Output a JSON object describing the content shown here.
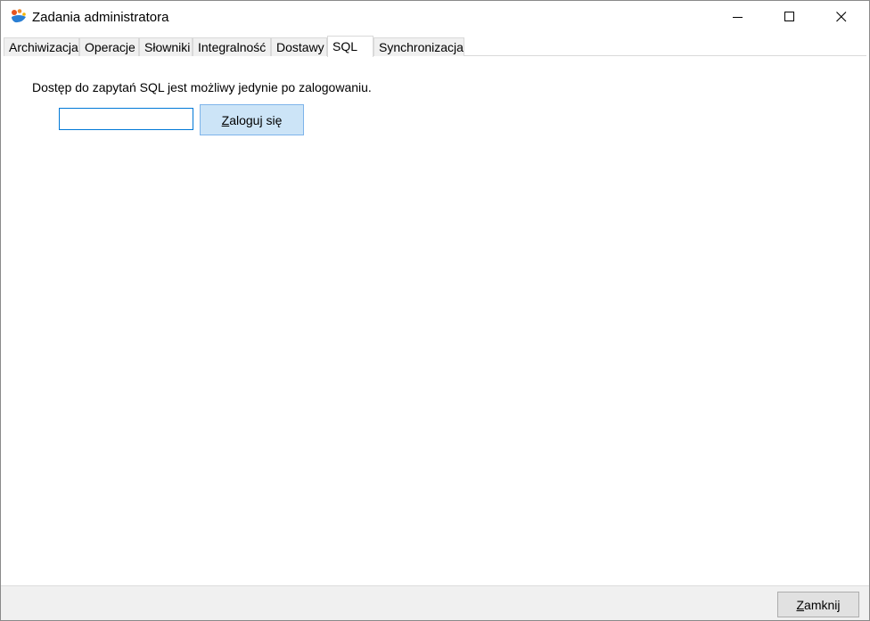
{
  "window": {
    "title": "Zadania administratora",
    "app_icon": "app-logo-icon",
    "controls": {
      "minimize_icon": "minimize-icon",
      "maximize_icon": "maximize-icon",
      "close_icon": "close-icon"
    }
  },
  "tabs": [
    {
      "label": "Archiwizacja",
      "active": false
    },
    {
      "label": "Operacje",
      "active": false
    },
    {
      "label": "Słowniki",
      "active": false
    },
    {
      "label": "Integralność",
      "active": false
    },
    {
      "label": "Dostawy",
      "active": false
    },
    {
      "label": "SQL",
      "active": true
    },
    {
      "label": "Synchronizacja",
      "active": false
    }
  ],
  "sql_tab": {
    "info": "Dostęp do zapytań SQL jest możliwy jedynie po zalogowaniu.",
    "password_value": "",
    "login_button": {
      "mnemonic": "Z",
      "rest": "aloguj się"
    }
  },
  "footer": {
    "close_button": {
      "mnemonic": "Z",
      "rest": "amknij"
    }
  },
  "colors": {
    "accent_border": "#0078d7",
    "login_button_bg": "#cce4f7",
    "login_button_border": "#7eb4ea",
    "footer_bg": "#f0f0f0"
  }
}
